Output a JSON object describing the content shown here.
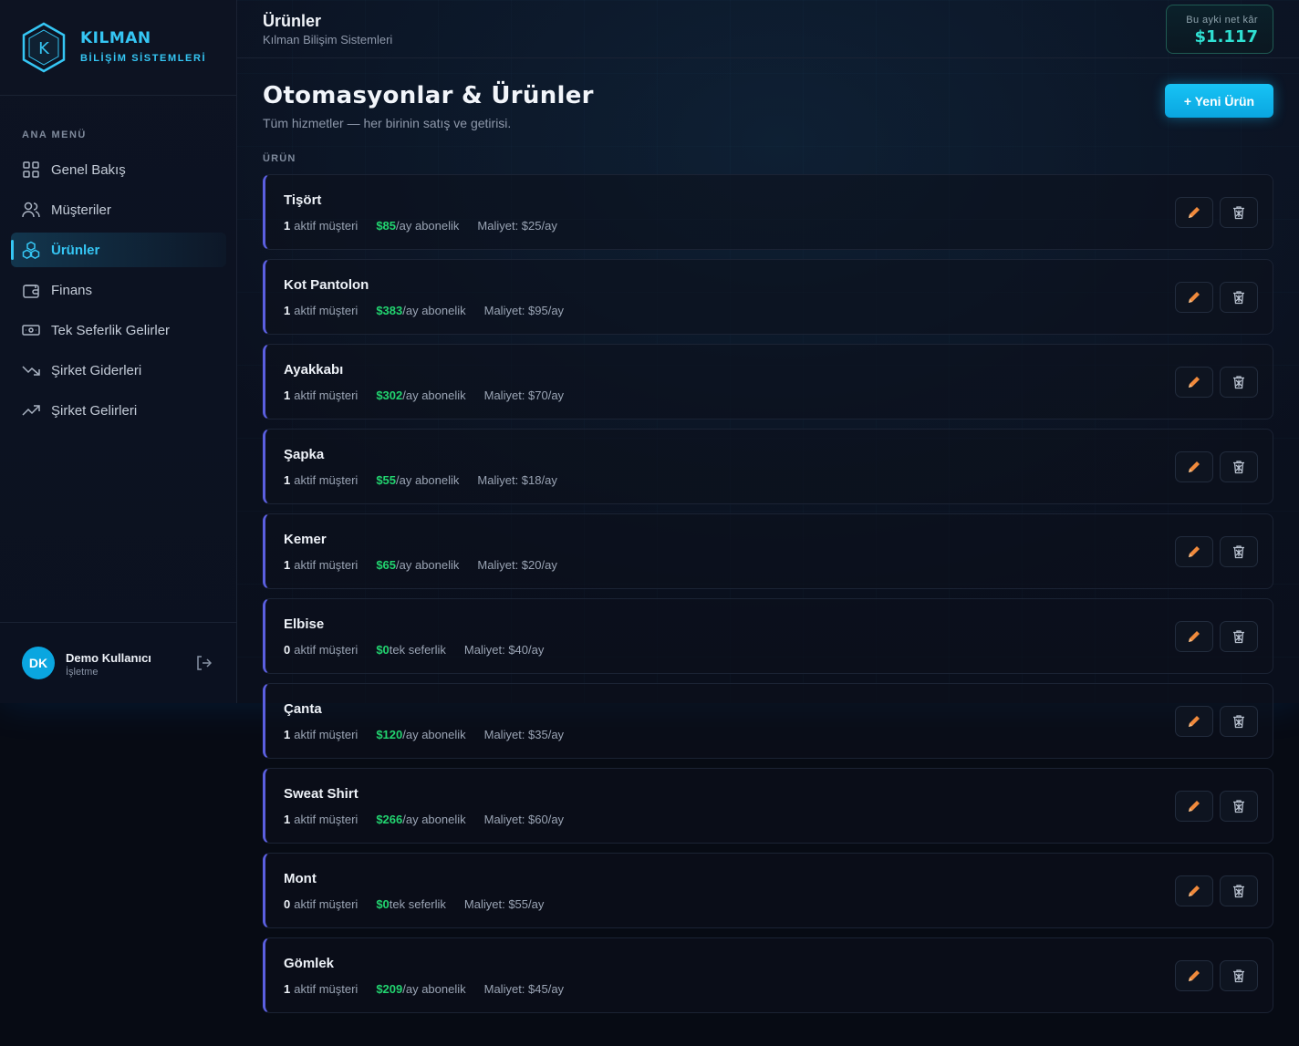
{
  "brand": {
    "name": "KILMAN",
    "subtitle": "BİLİŞİM SİSTEMLERİ",
    "logo_letter": "K"
  },
  "sidebar": {
    "menu_title": "ANA MENÜ",
    "items": [
      {
        "label": "Genel Bakış",
        "icon": "grid-icon",
        "active": false
      },
      {
        "label": "Müşteriler",
        "icon": "users-icon",
        "active": false
      },
      {
        "label": "Ürünler",
        "icon": "boxes-icon",
        "active": true
      },
      {
        "label": "Finans",
        "icon": "wallet-icon",
        "active": false
      },
      {
        "label": "Tek Seferlik Gelirler",
        "icon": "cash-icon",
        "active": false
      },
      {
        "label": "Şirket Giderleri",
        "icon": "trend-down-icon",
        "active": false
      },
      {
        "label": "Şirket Gelirleri",
        "icon": "trend-up-icon",
        "active": false
      }
    ],
    "user": {
      "initials": "DK",
      "name": "Demo Kullanıcı",
      "role": "İşletme"
    }
  },
  "header": {
    "title": "Ürünler",
    "subtitle": "Kılman Bilişim Sistemleri",
    "profit_label": "Bu ayki net kâr",
    "profit_value": "$1.117"
  },
  "main": {
    "title": "Otomasyonlar & Ürünler",
    "subtitle": "Tüm hizmetler — her birinin satış ve getirisi.",
    "new_button": "+ Yeni Ürün",
    "column_header": "ÜRÜN",
    "customers_suffix": "aktif müşteri",
    "products": [
      {
        "name": "Tişört",
        "customers": "1",
        "price": "$85",
        "price_suffix": "/ay abonelik",
        "cost": "Maliyet: $25/ay"
      },
      {
        "name": "Kot Pantolon",
        "customers": "1",
        "price": "$383",
        "price_suffix": "/ay abonelik",
        "cost": "Maliyet: $95/ay"
      },
      {
        "name": "Ayakkabı",
        "customers": "1",
        "price": "$302",
        "price_suffix": "/ay abonelik",
        "cost": "Maliyet: $70/ay"
      },
      {
        "name": "Şapka",
        "customers": "1",
        "price": "$55",
        "price_suffix": "/ay abonelik",
        "cost": "Maliyet: $18/ay"
      },
      {
        "name": "Kemer",
        "customers": "1",
        "price": "$65",
        "price_suffix": "/ay abonelik",
        "cost": "Maliyet: $20/ay"
      },
      {
        "name": "Elbise",
        "customers": "0",
        "price": "$0",
        "price_suffix": " tek seferlik",
        "cost": "Maliyet: $40/ay"
      },
      {
        "name": "Çanta",
        "customers": "1",
        "price": "$120",
        "price_suffix": "/ay abonelik",
        "cost": "Maliyet: $35/ay"
      },
      {
        "name": "Sweat Shirt",
        "customers": "1",
        "price": "$266",
        "price_suffix": "/ay abonelik",
        "cost": "Maliyet: $60/ay"
      },
      {
        "name": "Mont",
        "customers": "0",
        "price": "$0",
        "price_suffix": " tek seferlik",
        "cost": "Maliyet: $55/ay"
      },
      {
        "name": "Gömlek",
        "customers": "1",
        "price": "$209",
        "price_suffix": "/ay abonelik",
        "cost": "Maliyet: $45/ay"
      }
    ]
  },
  "colors": {
    "accent": "#35c6f4",
    "price_green": "#22d36f",
    "card_border_left": "#5b5fe0",
    "profit": "#2fe0d2",
    "edit_icon": "#f08a3c"
  }
}
